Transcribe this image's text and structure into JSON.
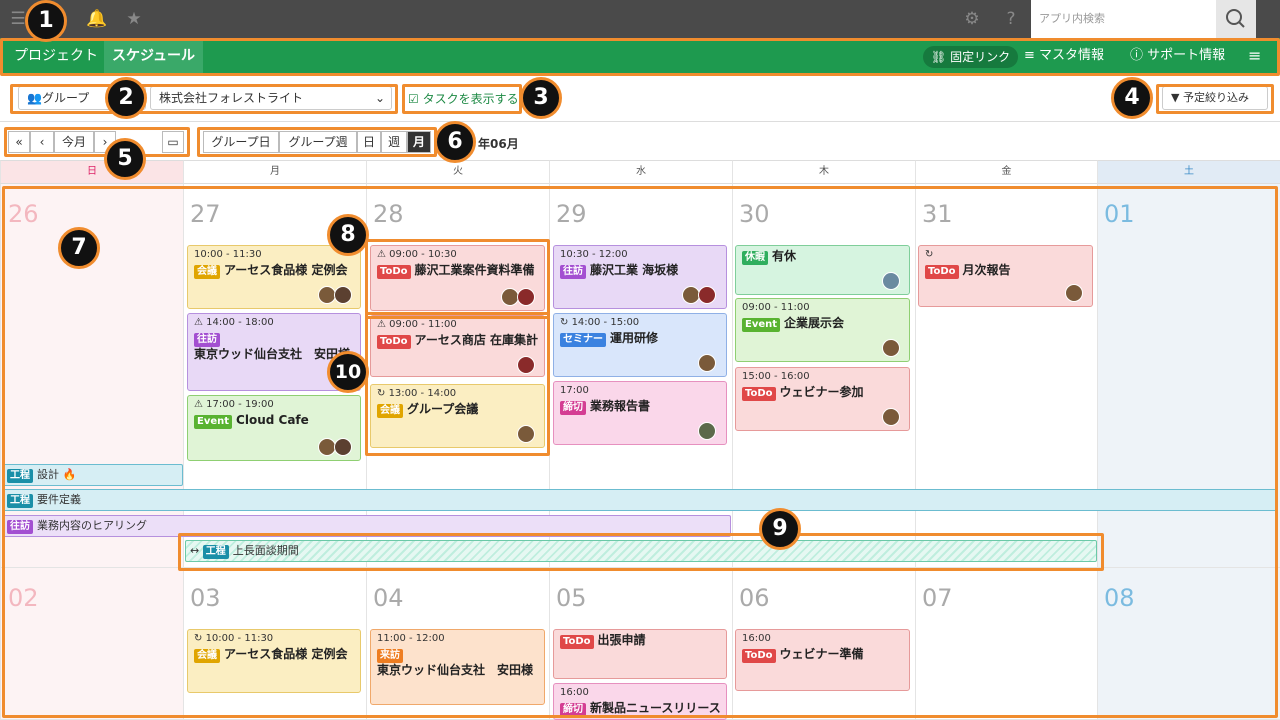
{
  "topbar": {
    "search_placeholder": "アプリ内検索"
  },
  "nav": {
    "tabs": [
      {
        "label": "プロジェクト"
      },
      {
        "label": "スケジュール"
      }
    ],
    "fixed_link": "固定リンク",
    "master": "マスタ情報",
    "support": "サポート情報"
  },
  "filters": {
    "group_label": "グループ",
    "company": "株式会社フォレストライト",
    "show_tasks": "タスクを表示する",
    "narrow": "予定絞り込み"
  },
  "toolbar": {
    "first": "«",
    "prev": "‹",
    "today": "今月",
    "views": [
      "グループ日",
      "グループ週",
      "日",
      "週",
      "月"
    ],
    "month": "年06月"
  },
  "weekdays": [
    "日",
    "月",
    "火",
    "水",
    "木",
    "金",
    "土"
  ],
  "week1": {
    "days": [
      "26",
      "27",
      "28",
      "29",
      "30",
      "31",
      "01"
    ]
  },
  "week2": {
    "days": [
      "02",
      "03",
      "04",
      "05",
      "06",
      "07",
      "08"
    ]
  },
  "events": {
    "e1": {
      "time": "10:00 - 11:30",
      "tag": "会議",
      "title": "アーセス食品様 定例会"
    },
    "e2": {
      "time": "14:00 - 18:00",
      "tag": "往訪",
      "title": "東京ウッド仙台支社　安田様"
    },
    "e3": {
      "time": "17:00 - 19:00",
      "tag": "Event",
      "title": "Cloud Cafe"
    },
    "e4": {
      "time": "09:00 - 10:30",
      "tag": "ToDo",
      "title": "藤沢工業案件資料準備"
    },
    "e5": {
      "time": "09:00 - 11:00",
      "tag": "ToDo",
      "title": "アーセス商店 在庫集計"
    },
    "e6": {
      "time": "13:00 - 14:00",
      "tag": "会議",
      "title": "グループ会議"
    },
    "e7": {
      "time": "10:30 - 12:00",
      "tag": "往訪",
      "title": "藤沢工業 海坂様"
    },
    "e8": {
      "time": "14:00 - 15:00",
      "tag": "セミナー",
      "title": "運用研修"
    },
    "e9": {
      "time": "17:00",
      "tag": "締切",
      "title": "業務報告書"
    },
    "e10": {
      "tag": "休暇",
      "title": "有休"
    },
    "e11": {
      "time": "09:00 - 11:00",
      "tag": "Event",
      "title": "企業展示会"
    },
    "e12": {
      "time": "15:00 - 16:00",
      "tag": "ToDo",
      "title": "ウェビナー参加"
    },
    "e13": {
      "tag": "ToDo",
      "title": "月次報告"
    },
    "e14": {
      "time": "10:00 - 11:30",
      "tag": "会議",
      "title": "アーセス食品様 定例会"
    },
    "e15": {
      "time": "11:00 - 12:00",
      "tag": "来訪",
      "title": "東京ウッド仙台支社　安田様"
    },
    "e16": {
      "tag": "ToDo",
      "title": "出張申請"
    },
    "e17": {
      "time": "16:00",
      "tag": "締切",
      "title": "新製品ニュースリリース"
    },
    "e18": {
      "time": "16:00",
      "tag": "ToDo",
      "title": "ウェビナー準備"
    }
  },
  "bars": {
    "b1": {
      "tag": "工程",
      "title": "設計 🔥"
    },
    "b2": {
      "tag": "工程",
      "title": "要件定義"
    },
    "b3": {
      "tag": "往訪",
      "title": "業務内容のヒアリング"
    },
    "b4": {
      "tag": "工程",
      "title": "上長面談期間"
    }
  },
  "badges": [
    "1",
    "2",
    "3",
    "4",
    "5",
    "6",
    "7",
    "8",
    "9",
    "10"
  ]
}
